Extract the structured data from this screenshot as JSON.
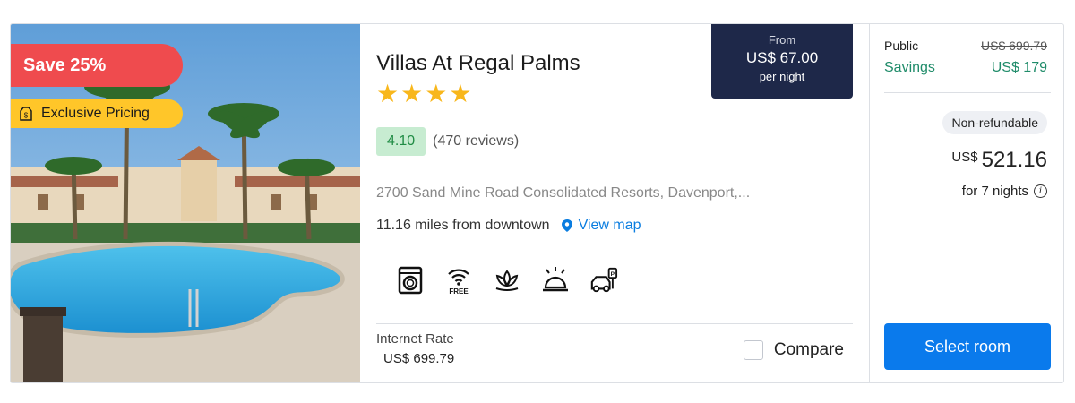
{
  "hotel": {
    "name": "Villas At Regal Palms",
    "stars": 4,
    "rating_score": "4.10",
    "rating_reviews": "(470 reviews)",
    "address": "2700 Sand Mine Road Consolidated Resorts, Davenport,...",
    "distance": "11.16 miles from downtown",
    "view_map_label": "View map",
    "amenity_icons": [
      "washing-machine-icon",
      "free-wifi-icon",
      "spa-lotus-icon",
      "room-service-bell-icon",
      "parking-icon"
    ],
    "free_label": "FREE"
  },
  "badges": {
    "save": "Save 25%",
    "exclusive": "Exclusive Pricing"
  },
  "price_box": {
    "from_label": "From",
    "amount": "US$ 67.00",
    "per_night": "per night"
  },
  "bottom": {
    "rate_label": "Internet Rate",
    "rate_value": "US$ 699.79",
    "compare_label": "Compare"
  },
  "price_panel": {
    "public_label": "Public",
    "public_value": "US$ 699.79",
    "savings_label": "Savings",
    "savings_value": "US$ 179",
    "nonrefundable": "Non-refundable",
    "total_currency": "US$",
    "total_amount": "521.16",
    "nights": "for 7 nights",
    "select_label": "Select room"
  },
  "colors": {
    "save_badge": "#ef4b4e",
    "exclusive_badge": "#ffc629",
    "star": "#f8b71c",
    "rating_bg": "#c7ecd1",
    "price_box_bg": "#1e2849",
    "savings": "#208c6a",
    "link": "#0a7de0",
    "select_button": "#0a7aec"
  }
}
